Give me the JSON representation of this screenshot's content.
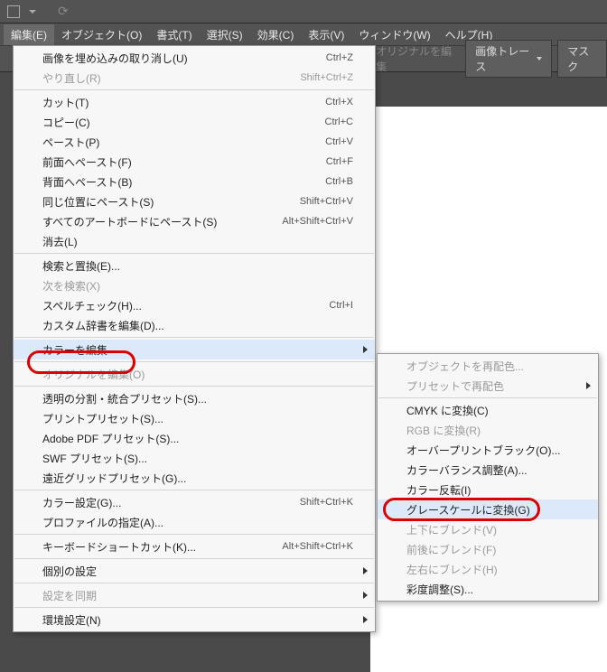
{
  "menubar": {
    "items": [
      {
        "label": "編集(E)"
      },
      {
        "label": "オブジェクト(O)"
      },
      {
        "label": "書式(T)"
      },
      {
        "label": "選択(S)"
      },
      {
        "label": "効果(C)"
      },
      {
        "label": "表示(V)"
      },
      {
        "label": "ウィンドウ(W)"
      },
      {
        "label": "ヘルプ(H)"
      }
    ]
  },
  "secondbar": {
    "orig": "オリジナルを編集",
    "trace": "画像トレース",
    "mask": "マスク"
  },
  "menu1": [
    {
      "t": "item",
      "label": "画像を埋め込みの取り消し(U)",
      "sc": "Ctrl+Z"
    },
    {
      "t": "item",
      "label": "やり直し(R)",
      "sc": "Shift+Ctrl+Z",
      "disabled": true
    },
    {
      "t": "sep"
    },
    {
      "t": "item",
      "label": "カット(T)",
      "sc": "Ctrl+X"
    },
    {
      "t": "item",
      "label": "コピー(C)",
      "sc": "Ctrl+C"
    },
    {
      "t": "item",
      "label": "ペースト(P)",
      "sc": "Ctrl+V"
    },
    {
      "t": "item",
      "label": "前面へペースト(F)",
      "sc": "Ctrl+F"
    },
    {
      "t": "item",
      "label": "背面へペースト(B)",
      "sc": "Ctrl+B"
    },
    {
      "t": "item",
      "label": "同じ位置にペースト(S)",
      "sc": "Shift+Ctrl+V"
    },
    {
      "t": "item",
      "label": "すべてのアートボードにペースト(S)",
      "sc": "Alt+Shift+Ctrl+V"
    },
    {
      "t": "item",
      "label": "消去(L)"
    },
    {
      "t": "sep"
    },
    {
      "t": "item",
      "label": "検索と置換(E)..."
    },
    {
      "t": "item",
      "label": "次を検索(X)",
      "disabled": true
    },
    {
      "t": "item",
      "label": "スペルチェック(H)...",
      "sc": "Ctrl+I"
    },
    {
      "t": "item",
      "label": "カスタム辞書を編集(D)..."
    },
    {
      "t": "sep"
    },
    {
      "t": "item",
      "label": "カラーを編集",
      "sub": true,
      "hl": true
    },
    {
      "t": "sep"
    },
    {
      "t": "item",
      "label": "オリジナルを編集(O)",
      "disabled": true
    },
    {
      "t": "sep"
    },
    {
      "t": "item",
      "label": "透明の分割・統合プリセット(S)..."
    },
    {
      "t": "item",
      "label": "プリントプリセット(S)..."
    },
    {
      "t": "item",
      "label": "Adobe PDF プリセット(S)..."
    },
    {
      "t": "item",
      "label": "SWF プリセット(S)..."
    },
    {
      "t": "item",
      "label": "遠近グリッドプリセット(G)..."
    },
    {
      "t": "sep"
    },
    {
      "t": "item",
      "label": "カラー設定(G)...",
      "sc": "Shift+Ctrl+K"
    },
    {
      "t": "item",
      "label": "プロファイルの指定(A)..."
    },
    {
      "t": "sep"
    },
    {
      "t": "item",
      "label": "キーボードショートカット(K)...",
      "sc": "Alt+Shift+Ctrl+K"
    },
    {
      "t": "sep"
    },
    {
      "t": "item",
      "label": "個別の設定",
      "sub": true
    },
    {
      "t": "sep"
    },
    {
      "t": "item",
      "label": "設定を同期",
      "disabled": true,
      "sub": true
    },
    {
      "t": "sep"
    },
    {
      "t": "item",
      "label": "環境設定(N)",
      "sub": true
    }
  ],
  "menu2": [
    {
      "t": "item",
      "label": "オブジェクトを再配色...",
      "disabled": true
    },
    {
      "t": "item",
      "label": "プリセットで再配色",
      "disabled": true,
      "sub": true
    },
    {
      "t": "sep"
    },
    {
      "t": "item",
      "label": "CMYK に変換(C)"
    },
    {
      "t": "item",
      "label": "RGB に変換(R)",
      "disabled": true
    },
    {
      "t": "item",
      "label": "オーバープリントブラック(O)..."
    },
    {
      "t": "item",
      "label": "カラーバランス調整(A)..."
    },
    {
      "t": "item",
      "label": "カラー反転(I)"
    },
    {
      "t": "item",
      "label": "グレースケールに変換(G)",
      "hl": true
    },
    {
      "t": "item",
      "label": "上下にブレンド(V)",
      "disabled": true
    },
    {
      "t": "item",
      "label": "前後にブレンド(F)",
      "disabled": true
    },
    {
      "t": "item",
      "label": "左右にブレンド(H)",
      "disabled": true
    },
    {
      "t": "item",
      "label": "彩度調整(S)..."
    }
  ]
}
